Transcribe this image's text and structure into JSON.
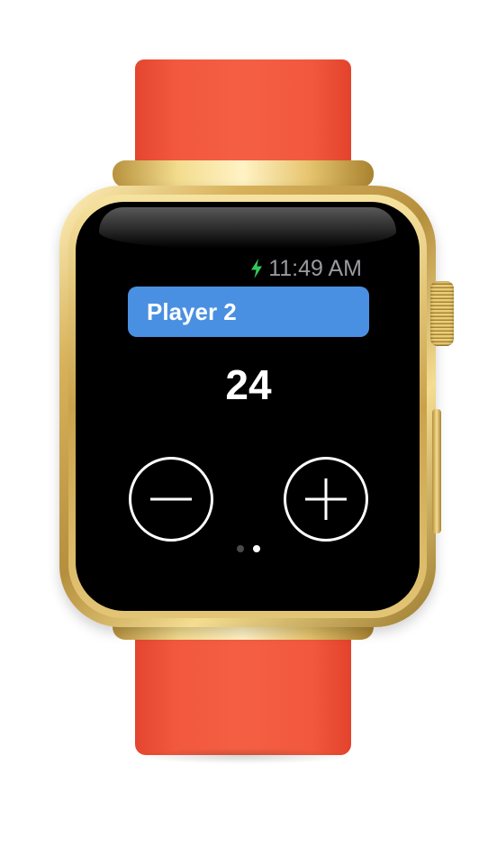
{
  "status_bar": {
    "time": "11:49 AM",
    "charging_icon": "charging-bolt-icon",
    "charging_color": "#34c759"
  },
  "player": {
    "name": "Player 2",
    "score": "24",
    "accent_color": "#4a90e2"
  },
  "controls": {
    "decrement_icon": "minus-circle-icon",
    "increment_icon": "plus-circle-icon"
  },
  "pagination": {
    "pages": 2,
    "current": 2
  },
  "device": {
    "band_color": "#f2583e",
    "case_color": "#d4af5a"
  }
}
